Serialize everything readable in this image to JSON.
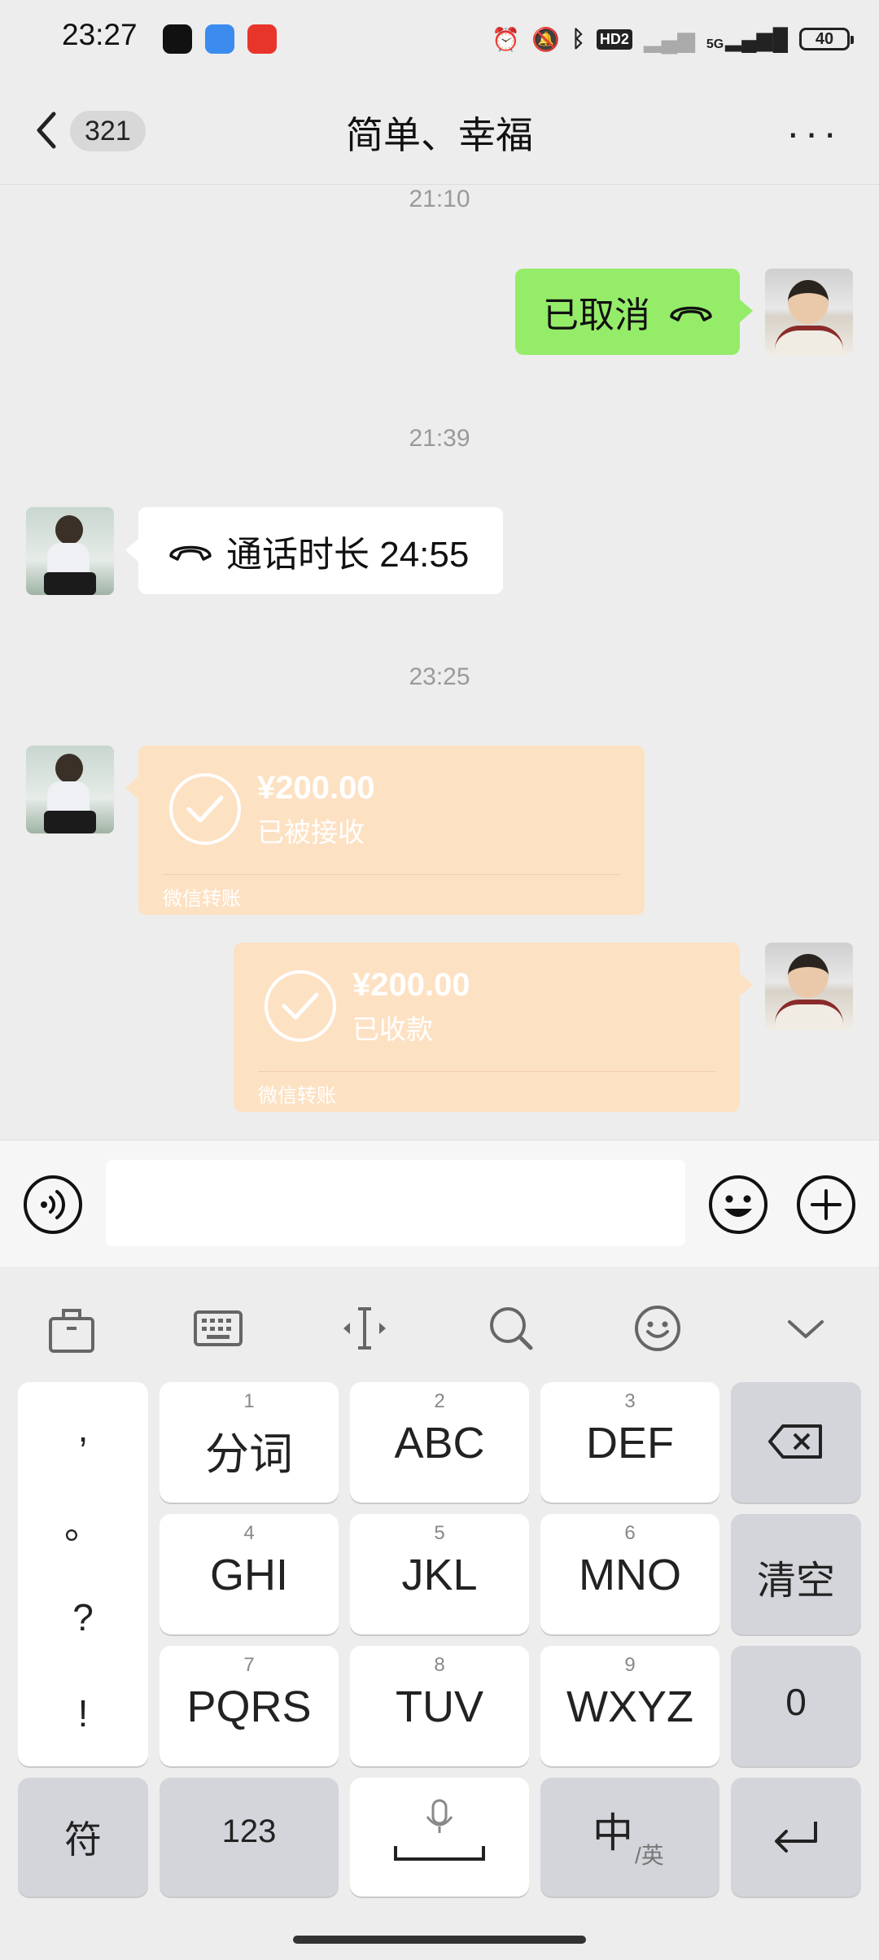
{
  "status_bar": {
    "time": "23:27",
    "icons": [
      "black-app-icon",
      "blue-app-icon",
      "red-app-icon",
      "alarm-icon",
      "mute-bell-icon",
      "bluetooth-icon",
      "hd-icon",
      "signal-icon",
      "5g-signal-icon"
    ],
    "network": "5G",
    "hd": "HD2",
    "battery": "40"
  },
  "header": {
    "unread_count": "321",
    "title": "简单、幸福",
    "more": "···"
  },
  "messages": [
    {
      "type": "timestamp",
      "text": "21:10"
    },
    {
      "type": "call",
      "side": "right",
      "text": "已取消"
    },
    {
      "type": "timestamp",
      "text": "21:39"
    },
    {
      "type": "call",
      "side": "left",
      "text": "通话时长 24:55"
    },
    {
      "type": "timestamp",
      "text": "23:25"
    },
    {
      "type": "transfer",
      "side": "left",
      "amount": "¥200.00",
      "status": "已被接收",
      "footer": "微信转账"
    },
    {
      "type": "transfer",
      "side": "right",
      "amount": "¥200.00",
      "status": "已收款",
      "footer": "微信转账"
    }
  ],
  "input_bar": {
    "voice": "voice-icon",
    "emoji": "emoji-icon",
    "plus": "plus-icon"
  },
  "keyboard": {
    "toolbar": [
      "briefcase-icon",
      "keyboard-icon",
      "cursor-icon",
      "search-icon",
      "emoji-icon",
      "chevron-down-icon"
    ],
    "punct": [
      ",",
      "。",
      "?",
      "!"
    ],
    "keys": [
      {
        "num": "1",
        "label": "分词"
      },
      {
        "num": "2",
        "label": "ABC"
      },
      {
        "num": "3",
        "label": "DEF"
      },
      {
        "num": "4",
        "label": "GHI"
      },
      {
        "num": "5",
        "label": "JKL"
      },
      {
        "num": "6",
        "label": "MNO"
      },
      {
        "num": "7",
        "label": "PQRS"
      },
      {
        "num": "8",
        "label": "TUV"
      },
      {
        "num": "9",
        "label": "WXYZ"
      }
    ],
    "clear": "清空",
    "zero": "0",
    "symbols": "符",
    "num_mode": "123",
    "lang_main": "中",
    "lang_sub": "/英"
  }
}
